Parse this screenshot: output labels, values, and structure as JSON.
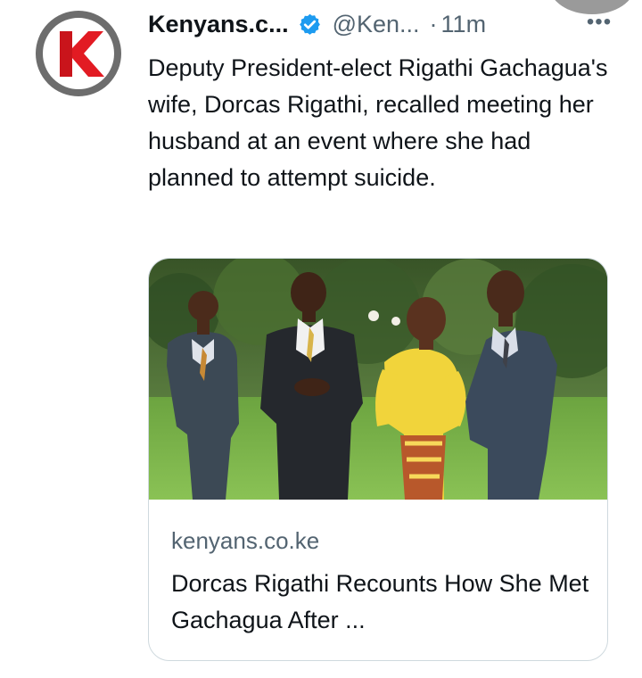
{
  "tweet": {
    "display_name": "Kenyans.c...",
    "handle": "@Ken...",
    "separator": "·",
    "timestamp": "11m",
    "more_label": "•••",
    "text": "Deputy President-elect Rigathi Gachagua's wife, Dorcas Rigathi, recalled meeting her husband at an event where she had planned to attempt suicide.",
    "avatar_icon": "kenyans-k-logo-icon",
    "verified_icon": "verified-badge-icon"
  },
  "card": {
    "image_icon": "group-photo-four-people",
    "domain": "kenyans.co.ke",
    "title": "Dorcas Rigathi Recounts How She Met Gachagua After ..."
  },
  "colors": {
    "text_primary": "#0f1419",
    "text_secondary": "#536471",
    "verified_blue": "#1d9bf0",
    "brand_red": "#e21b23",
    "card_border": "#cfd9de"
  }
}
